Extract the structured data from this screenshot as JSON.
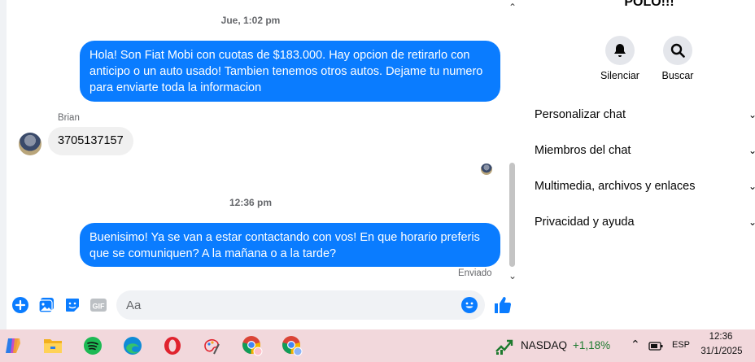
{
  "chat": {
    "timestamp_1": "Jue, 1:02 pm",
    "message_1": "Hola! Son Fiat Mobi con cuotas de $183.000. Hay opcion de retirarlo con anticipo o un auto usado! Tambien tenemos otros autos. Dejame tu numero para enviarte toda la informacion",
    "sender_name": "Brian",
    "reply_1": "3705137157",
    "timestamp_2": "12:36 pm",
    "message_2": "Buenisimo! Ya se van a estar contactando con vos! En que horario preferis que se comuniquen? A la mañana o a la tarde?",
    "status": "Enviado",
    "composer_placeholder": "Aa"
  },
  "info": {
    "title": "POLO!!!",
    "actions": [
      {
        "label": "Silenciar",
        "icon": "bell-icon"
      },
      {
        "label": "Buscar",
        "icon": "search-icon"
      }
    ],
    "menu": [
      {
        "label": "Personalizar chat"
      },
      {
        "label": "Miembros del chat"
      },
      {
        "label": "Multimedia, archivos y enlaces"
      },
      {
        "label": "Privacidad y ayuda"
      }
    ]
  },
  "taskbar": {
    "apps": [
      "copilot-icon",
      "file-explorer-icon",
      "spotify-icon",
      "edge-icon",
      "opera-icon",
      "paint-icon",
      "chrome-icon",
      "chrome-profile-icon"
    ],
    "stock_name": "NASDAQ",
    "stock_change": "+1,18%",
    "language": "ESP",
    "time": "12:36",
    "date": "31/1/2025"
  },
  "colors": {
    "accent": "#0a7cff",
    "taskbar": "#f2d8dc",
    "stock_up": "#1d7a2e"
  }
}
